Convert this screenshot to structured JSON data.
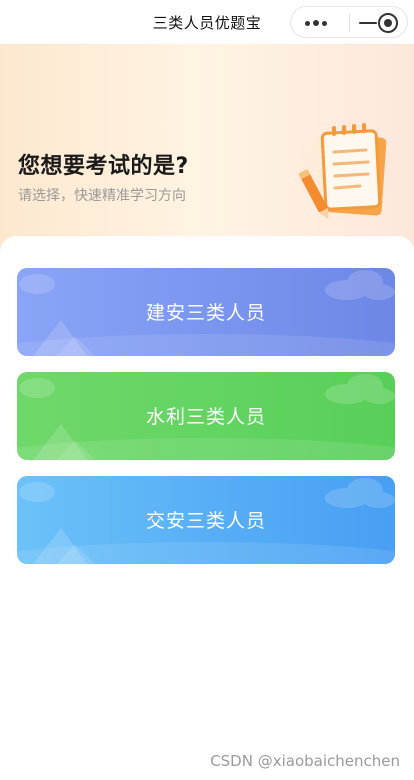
{
  "window": {
    "title": "三类人员优题宝"
  },
  "capsule": {
    "more_icon": "more-dots-icon",
    "minimize_icon": "minimize-icon",
    "close_icon": "record-close-icon"
  },
  "hero": {
    "title": "您想要考试的是?",
    "subtitle": "请选择，快速精准学习方向",
    "illustration": "notebook-pencil-illustration"
  },
  "options": [
    {
      "label": "建安三类人员",
      "color": "#7b96ef"
    },
    {
      "label": "水利三类人员",
      "color": "#63d462"
    },
    {
      "label": "交安三类人员",
      "color": "#58aff6"
    }
  ],
  "watermark": "CSDN @xiaobaichenchen"
}
